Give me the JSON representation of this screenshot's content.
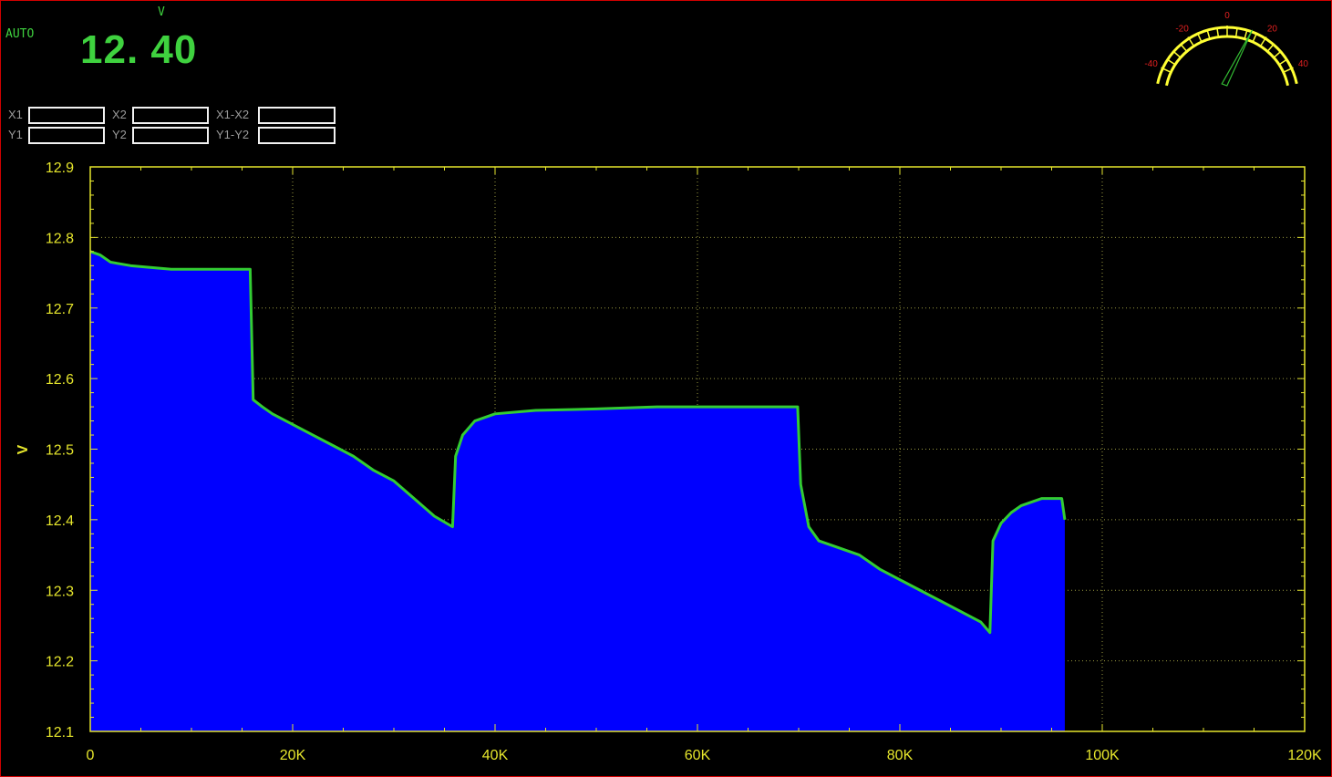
{
  "meter": {
    "mode": "AUTO",
    "unit": "V",
    "reading": "12. 40",
    "gauge_ticks": [
      "-40",
      "-20",
      "0",
      "20",
      "40"
    ],
    "gauge_needle_value": 12.4
  },
  "cursors": {
    "x1_label": "X1",
    "x2_label": "X2",
    "x_diff_label": "X1-X2",
    "y1_label": "Y1",
    "y2_label": "Y2",
    "y_diff_label": "Y1-Y2",
    "x1": "",
    "x2": "",
    "x_diff": "",
    "y1": "",
    "y2": "",
    "y_diff": ""
  },
  "colors": {
    "fill": "#0000ff",
    "trace": "#33cc33",
    "axis": "#e6e62c",
    "reading": "#3fd23f",
    "gauge_arc": "#ffff33",
    "gauge_ticks": "#e02020",
    "border": "#d00000"
  },
  "chart_data": {
    "type": "area",
    "ylabel": "V",
    "xlabel": "",
    "xlim": [
      0,
      120000
    ],
    "ylim": [
      12.1,
      12.9
    ],
    "xticks": [
      "0",
      "20K",
      "40K",
      "60K",
      "80K",
      "100K",
      "120K"
    ],
    "yticks": [
      "12.1",
      "12.2",
      "12.3",
      "12.4",
      "12.5",
      "12.6",
      "12.7",
      "12.8",
      "12.9"
    ],
    "grid": true,
    "series": [
      {
        "x": [
          0,
          1000,
          2000,
          4000,
          8000,
          12000,
          15800,
          16100,
          17000,
          18000,
          20000,
          22000,
          24000,
          26000,
          28000,
          30000,
          32000,
          34000,
          35800,
          36100,
          36800,
          38000,
          40000,
          44000,
          50000,
          56000,
          62000,
          66000,
          69900,
          70200,
          71000,
          72000,
          74000,
          76000,
          78000,
          80000,
          82000,
          84000,
          86000,
          88000,
          88900,
          89200,
          90000,
          91000,
          92000,
          94000,
          96000,
          96300
        ],
        "y": [
          12.78,
          12.775,
          12.765,
          12.76,
          12.755,
          12.755,
          12.755,
          12.57,
          12.56,
          12.55,
          12.535,
          12.52,
          12.505,
          12.49,
          12.47,
          12.455,
          12.43,
          12.405,
          12.39,
          12.49,
          12.52,
          12.54,
          12.55,
          12.555,
          12.557,
          12.56,
          12.56,
          12.56,
          12.56,
          12.45,
          12.39,
          12.37,
          12.36,
          12.35,
          12.33,
          12.315,
          12.3,
          12.285,
          12.27,
          12.255,
          12.24,
          12.37,
          12.395,
          12.41,
          12.42,
          12.43,
          12.43,
          12.4
        ]
      }
    ]
  }
}
